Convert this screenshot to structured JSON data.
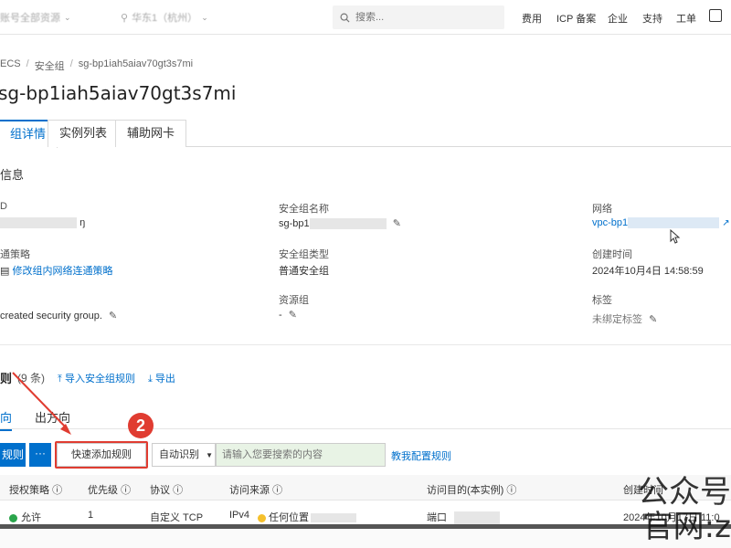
{
  "topbar": {
    "account": "账号全部资源",
    "region": "华东1（杭州）",
    "search_placeholder": "搜索...",
    "nav": [
      "费用",
      "ICP 备案",
      "企业",
      "支持",
      "工单"
    ]
  },
  "breadcrumb": [
    "ECS",
    "安全组",
    "sg-bp1iah5aiav70gt3s7mi"
  ],
  "page_title": "sg-bp1iah5aiav70gt3s7mi",
  "tabs": [
    "组详情",
    "实例列表",
    "辅助网卡"
  ],
  "basic_info": {
    "section_title": "信息",
    "id_label": "D",
    "id_value_suffix": "ŋ",
    "policy_label": "通策略",
    "policy_link": "修改组内网络连通策略",
    "desc_value": "created security group.",
    "name_label": "安全组名称",
    "name_value": "sg-bp1",
    "type_label": "安全组类型",
    "type_value": "普通安全组",
    "rg_label": "资源组",
    "rg_value": "-",
    "network_label": "网络",
    "network_value": "vpc-bp1",
    "created_label": "创建时间",
    "created_value": "2024年10月4日 14:58:59",
    "tags_label": "标签",
    "tags_value": "未绑定标签"
  },
  "rules": {
    "title": "则",
    "count": "(9 条)",
    "import_label": "导入安全组规则",
    "export_label": "导出",
    "dir_tabs": [
      "向",
      "出方向"
    ],
    "add_btn": "规则",
    "more_btn": "···",
    "quick_add": "快速添加规则",
    "auto_detect": "自动识别",
    "search_placeholder": "请输入您要搜索的内容",
    "teach_link": "教我配置规则",
    "columns": [
      "授权策略",
      "优先级",
      "协议",
      "访问来源",
      "访问目的(本实例)",
      "创建时间"
    ],
    "row": {
      "policy": "允许",
      "priority": "1",
      "protocol": "自定义 TCP",
      "source_type": "IPv4",
      "source_value": "任何位置",
      "dest": "端口",
      "created": "2024年10月17日 11:0"
    }
  },
  "annotation": {
    "step_number": "2"
  },
  "watermark": {
    "line1": "公众号",
    "line2": "官网:z"
  },
  "colors": {
    "accent": "#0070cc",
    "annotation": "#e03c31",
    "allow": "#2aa54b"
  }
}
